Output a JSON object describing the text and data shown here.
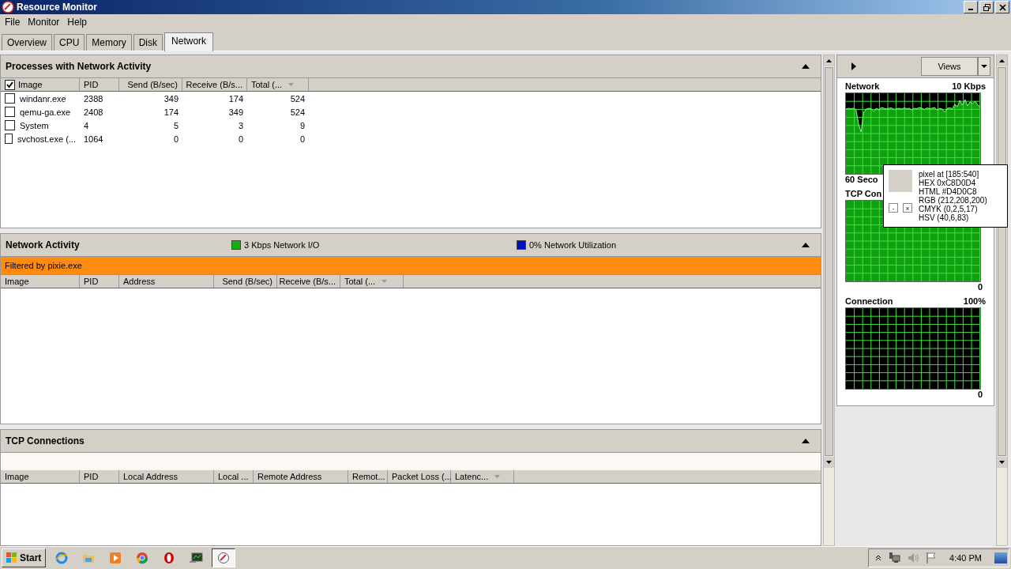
{
  "window": {
    "title": "Resource Monitor"
  },
  "menu": [
    "File",
    "Monitor",
    "Help"
  ],
  "tabs": [
    {
      "label": "Overview",
      "selected": false
    },
    {
      "label": "CPU",
      "selected": false
    },
    {
      "label": "Memory",
      "selected": false
    },
    {
      "label": "Disk",
      "selected": false
    },
    {
      "label": "Network",
      "selected": true
    }
  ],
  "sections": [
    {
      "title": "Processes with Network Activity",
      "expanded": true,
      "header_checked": true,
      "columns": [
        {
          "label": "Image",
          "sorted": false
        },
        {
          "label": "PID",
          "sorted": false
        },
        {
          "label": "Send (B/sec)",
          "sorted": false
        },
        {
          "label": "Receive (B/s...",
          "sorted": false
        },
        {
          "label": "Total (...",
          "sorted": true
        }
      ],
      "rows": [
        {
          "checked": false,
          "cells": [
            "windanr.exe",
            "2388",
            "349",
            "174",
            "524"
          ]
        },
        {
          "checked": false,
          "cells": [
            "qemu-ga.exe",
            "2408",
            "174",
            "349",
            "524"
          ]
        },
        {
          "checked": false,
          "cells": [
            "System",
            "4",
            "5",
            "3",
            "9"
          ]
        },
        {
          "checked": false,
          "cells": [
            "svchost.exe (...",
            "1064",
            "0",
            "0",
            "0"
          ]
        }
      ]
    },
    {
      "title": "Network Activity",
      "expanded": true,
      "legend": [
        {
          "label": "3 Kbps Network I/O",
          "color": "#10b010"
        },
        {
          "label": "0% Network Utilization",
          "color": "#0010c0"
        }
      ],
      "filter": "Filtered by pixie.exe",
      "columns": [
        {
          "label": "Image",
          "sorted": false
        },
        {
          "label": "PID",
          "sorted": false
        },
        {
          "label": "Address",
          "sorted": false
        },
        {
          "label": "Send (B/sec)",
          "sorted": false
        },
        {
          "label": "Receive (B/s...",
          "sorted": false
        },
        {
          "label": "Total (...",
          "sorted": true
        }
      ]
    },
    {
      "title": "TCP Connections",
      "expanded": true,
      "columns": [
        {
          "label": "Image",
          "sorted": false
        },
        {
          "label": "PID",
          "sorted": false
        },
        {
          "label": "Local Address",
          "sorted": false
        },
        {
          "label": "Local ...",
          "sorted": false
        },
        {
          "label": "Remote Address",
          "sorted": false
        },
        {
          "label": "Remot...",
          "sorted": false
        },
        {
          "label": "Packet Loss (...",
          "sorted": false
        },
        {
          "label": "Latenc...",
          "sorted": true
        }
      ]
    }
  ],
  "side": {
    "views_button": "Views",
    "graphs": [
      {
        "title": "Network",
        "top_label": "10 Kbps",
        "footer": "60 Seco",
        "filled": true
      },
      {
        "title": "TCP Con",
        "bottom_label": "0",
        "filled": true
      },
      {
        "title": "Connection",
        "top_label": "100%",
        "bottom_label": "0",
        "filled": false
      }
    ]
  },
  "popup": {
    "lines": [
      "pixel at [185:540]",
      "HEX 0xC8D0D4",
      "HTML #D4D0C8",
      "RGB (212,208,200)",
      "CMYK (0,2,5,17)",
      "HSV (40,6,83)"
    ],
    "buttons": [
      "-",
      "x"
    ]
  },
  "taskbar": {
    "start": "Start",
    "apps": [
      {
        "kind": "ie",
        "selected": false
      },
      {
        "kind": "folder",
        "selected": false
      },
      {
        "kind": "media",
        "selected": false
      },
      {
        "kind": "chrome",
        "selected": false
      },
      {
        "kind": "opera",
        "selected": false
      },
      {
        "kind": "netmon",
        "selected": false
      },
      {
        "kind": "resmon",
        "selected": true
      }
    ],
    "clock": "4:40 PM"
  }
}
